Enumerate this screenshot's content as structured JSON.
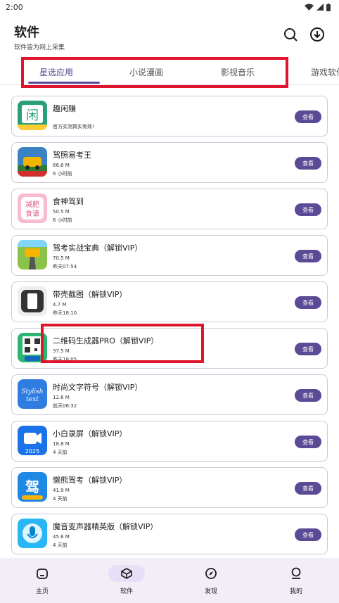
{
  "status": {
    "time": "2:00"
  },
  "header": {
    "title": "软件",
    "subtitle": "软件皆为网上采集",
    "search_icon": "search-icon",
    "download_icon": "download-icon"
  },
  "tabs": [
    {
      "label": "星选应用",
      "active": true
    },
    {
      "label": "小说漫画",
      "active": false
    },
    {
      "label": "影视音乐",
      "active": false
    },
    {
      "label": "游戏软件",
      "active": false
    }
  ],
  "apps": [
    {
      "name": "趣闲赚",
      "line1": "官方实测真实有效!",
      "line2": "",
      "button": "查看",
      "icon": "qxz",
      "color": "#2aa07a"
    },
    {
      "name": "驾照易考王",
      "line1": "66.6 M",
      "line2": "6 小时前",
      "button": "查看",
      "icon": "car",
      "color": "#f4b400"
    },
    {
      "name": "食神驾到",
      "line1": "50.5 M",
      "line2": "6 小时前",
      "button": "查看",
      "icon": "food",
      "color": "#e05a8a"
    },
    {
      "name": "驾考实战宝典（解锁VIP）",
      "line1": "70.5 M",
      "line2": "昨天07:54",
      "button": "查看",
      "icon": "road",
      "color": "#6bbf59"
    },
    {
      "name": "带壳截图（解锁VIP）",
      "line1": "4.7 M",
      "line2": "昨天18:10",
      "button": "查看",
      "icon": "phone",
      "color": "#444444"
    },
    {
      "name": "二维码生成器PRO（解锁VIP）",
      "line1": "37.5 M",
      "line2": "昨天18:05",
      "button": "查看",
      "icon": "qr",
      "color": "#2bb673"
    },
    {
      "name": "时尚文字符号（解锁VIP）",
      "line1": "12.6 M",
      "line2": "前天06:32",
      "button": "查看",
      "icon": "text",
      "color": "#2f7de1"
    },
    {
      "name": "小白录屏（解锁VIP）",
      "line1": "18.8 M",
      "line2": "4 天前",
      "button": "查看",
      "icon": "rec",
      "color": "#1a73e8"
    },
    {
      "name": "懒熊驾考（解锁VIP）",
      "line1": "41.9 M",
      "line2": "4 天前",
      "button": "查看",
      "icon": "bear",
      "color": "#1e88e5"
    },
    {
      "name": "魔音变声器精英版（解锁VIP）",
      "line1": "45.6 M",
      "line2": "4 天前",
      "button": "查看",
      "icon": "mic",
      "color": "#29b6f6"
    }
  ],
  "bottom_nav": [
    {
      "label": "主页",
      "icon": "home-icon",
      "active": false
    },
    {
      "label": "软件",
      "icon": "cube-icon",
      "active": true
    },
    {
      "label": "发现",
      "icon": "compass-icon",
      "active": false
    },
    {
      "label": "我的",
      "icon": "profile-icon",
      "active": false
    }
  ],
  "accent_color": "#5b4a96",
  "highlight_color": "#e0152b"
}
